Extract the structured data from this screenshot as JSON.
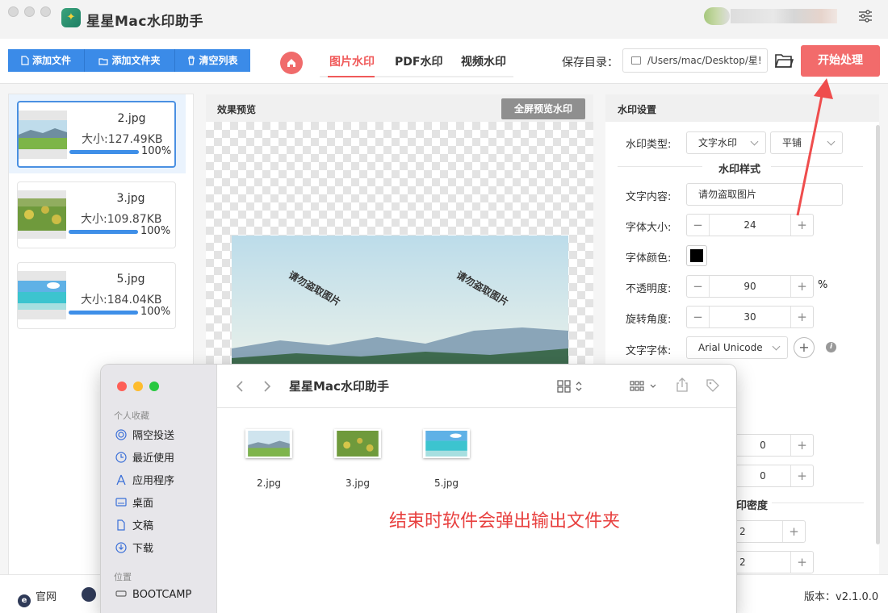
{
  "app": {
    "title": "星星Mac水印助手"
  },
  "toolbar": {
    "add_file": "添加文件",
    "add_folder": "添加文件夹",
    "clear_list": "清空列表",
    "tabs": [
      "图片水印",
      "PDF水印",
      "视频水印"
    ],
    "save_dir_label": "保存目录：",
    "save_dir_value": "/Users/mac/Desktop/星!",
    "start_button": "开始处理"
  },
  "files": [
    {
      "name": "2.jpg",
      "size": "大小:127.49KB",
      "progress": "100%",
      "progress_value": 1.0
    },
    {
      "name": "3.jpg",
      "size": "大小:109.87KB",
      "progress": "100%",
      "progress_value": 1.0
    },
    {
      "name": "5.jpg",
      "size": "大小:184.04KB",
      "progress": "100%",
      "progress_value": 1.0
    }
  ],
  "preview": {
    "title": "效果预览",
    "fullscreen_button": "全屏预览水印",
    "watermark_text": "请勿盗取图片"
  },
  "settings": {
    "title": "水印设置",
    "type_label": "水印类型:",
    "type_value": "文字水印",
    "layout_value": "平铺",
    "style_title": "水印样式",
    "text_label": "文字内容:",
    "text_value": "请勿盗取图片",
    "font_size_label": "字体大小:",
    "font_size_value": "24",
    "font_color_label": "字体颜色:",
    "font_color_value": "#000000",
    "opacity_label": "不透明度:",
    "opacity_value": "90",
    "opacity_unit": "%",
    "rotation_label": "旋转角度:",
    "rotation_value": "30",
    "font_family_label": "文字字体:",
    "font_family_value": "Arial Unicode",
    "hidden_value_1": "0",
    "hidden_value_2": "0",
    "density_label": "印密度",
    "density_value_1": "2",
    "density_value_2": "2"
  },
  "bottom": {
    "website": "官网",
    "version": "版本：v2.1.0.0"
  },
  "finder": {
    "title": "星星Mac水印助手",
    "section_favorites": "个人收藏",
    "favorites": [
      "隔空投送",
      "最近使用",
      "应用程序",
      "桌面",
      "文稿",
      "下载"
    ],
    "section_locations": "位置",
    "locations": [
      "BOOTCAMP"
    ],
    "files": [
      "2.jpg",
      "3.jpg",
      "5.jpg"
    ],
    "note": "结束时软件会弹出输出文件夹"
  },
  "colors": {
    "accent_red": "#f26b6b",
    "accent_blue": "#3b8be8",
    "note_red": "#e8403f"
  }
}
